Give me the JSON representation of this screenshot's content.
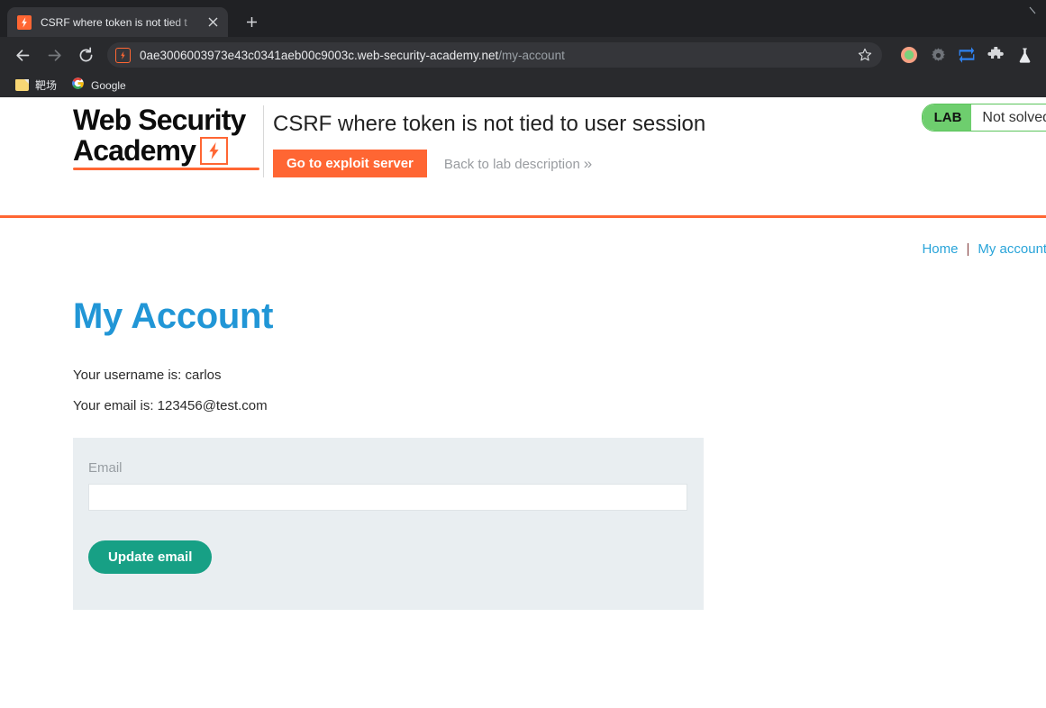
{
  "browser": {
    "tab": {
      "title": "CSRF where token is not tied t",
      "favicon": "lightning-bolt-favicon",
      "close": "×",
      "new_tab": "+"
    },
    "window_controls": {
      "minimize": "—"
    },
    "toolbar": {
      "back": "←",
      "forward": "→",
      "reload": "↻",
      "url_host": "0ae3006003973e43c0341aeb00c9003c.web-security-academy.net",
      "url_path": "/my-account",
      "site_icon": "lightning-bolt-site-icon",
      "star": "☆",
      "icons": [
        "profile-avatar-icon",
        "gear-icon",
        "sync-arrows-icon",
        "extensions-puzzle-icon",
        "flask-icon"
      ]
    },
    "bookmarks": [
      {
        "label": "靶场",
        "icon": "folder-icon"
      },
      {
        "label": "Google",
        "icon": "google-icon"
      }
    ]
  },
  "lab": {
    "logo": {
      "line1": "Web Security",
      "line2": "Academy",
      "bolt": "lightning-bolt-logo-icon"
    },
    "title": "CSRF where token is not tied to user session",
    "exploit_button": "Go to exploit server",
    "back_link": "Back to lab description",
    "back_chevron": "»",
    "status_tag": "LAB",
    "status_state": "Not solved",
    "accent_orange": "#ff6633",
    "status_green": "#6ece6e"
  },
  "nav": {
    "links": [
      "Home",
      "My account"
    ],
    "separator": "|",
    "link_color": "#29a4d9"
  },
  "main": {
    "heading": "My Account",
    "username_line": "Your username is: carlos",
    "email_line": "Your email is: 123456@test.com",
    "form": {
      "label": "Email",
      "input_value": "",
      "input_placeholder": "",
      "submit_label": "Update email",
      "submit_color": "#17a085",
      "panel_bg": "#e9eef1"
    }
  }
}
